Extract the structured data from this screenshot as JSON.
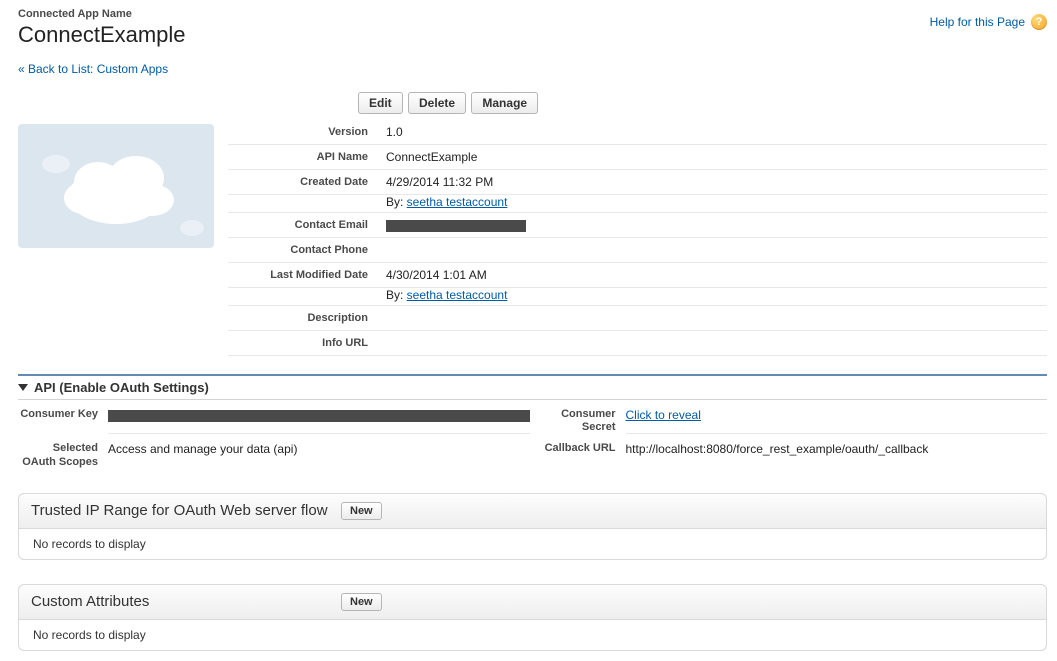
{
  "header": {
    "small_title": "Connected App Name",
    "large_title": "ConnectExample",
    "help_text": "Help for this Page"
  },
  "back_link": "« Back to List: Custom Apps",
  "toolbar": {
    "edit": "Edit",
    "delete": "Delete",
    "manage": "Manage"
  },
  "details": {
    "version_label": "Version",
    "version_value": "1.0",
    "api_name_label": "API Name",
    "api_name_value": "ConnectExample",
    "created_label": "Created Date",
    "created_value": "4/29/2014 11:32 PM",
    "by_prefix": "By: ",
    "created_by": "seetha testaccount",
    "contact_email_label": "Contact Email",
    "contact_phone_label": "Contact Phone",
    "modified_label": "Last Modified Date",
    "modified_value": "4/30/2014 1:01 AM",
    "modified_by": "seetha testaccount",
    "description_label": "Description",
    "info_url_label": "Info URL"
  },
  "api_section": {
    "title": "API (Enable OAuth Settings)",
    "consumer_key_label": "Consumer Key",
    "consumer_secret_label": "Consumer Secret",
    "consumer_secret_value": "Click to reveal",
    "scopes_label": "Selected OAuth Scopes",
    "scopes_value": "Access and manage your data (api)",
    "callback_label": "Callback URL",
    "callback_value": "http://localhost:8080/force_rest_example/oauth/_callback"
  },
  "panels": {
    "ip_title": "Trusted IP Range for OAuth Web server flow",
    "attr_title": "Custom Attributes",
    "new_btn": "New",
    "empty_msg": "No records to display"
  }
}
